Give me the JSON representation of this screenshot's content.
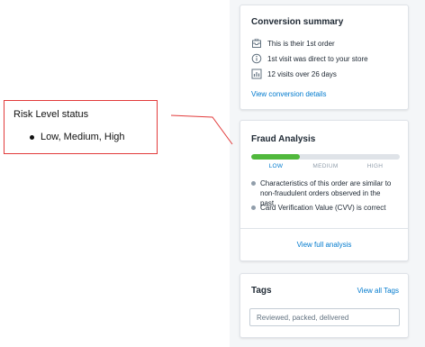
{
  "conversion": {
    "title": "Conversion summary",
    "items": [
      {
        "icon": "order-icon",
        "text": "This is their 1st order"
      },
      {
        "icon": "info-icon",
        "text": "1st visit was direct to your store"
      },
      {
        "icon": "chart-icon",
        "text": "12 visits over 26 days"
      }
    ],
    "details_link": "View conversion details"
  },
  "fraud": {
    "title": "Fraud Analysis",
    "risk_level": 0.33,
    "levels": [
      "LOW",
      "MEDIUM",
      "HIGH"
    ],
    "active_level": "LOW",
    "bullets": [
      "Characteristics of this order are similar to non-fraudulent orders observed in the past",
      "Card Verification Value (CVV) is correct"
    ],
    "full_analysis_link": "View full analysis"
  },
  "tags": {
    "title": "Tags",
    "view_all_link": "View all Tags",
    "value": "Reviewed, packed, delivered"
  },
  "annotation": {
    "title": "Risk Level status",
    "bullet": "Low, Medium, High"
  },
  "colors": {
    "accent_link": "#007ace",
    "risk_low": "#50b83c",
    "annotation_border": "#e23b3b"
  }
}
